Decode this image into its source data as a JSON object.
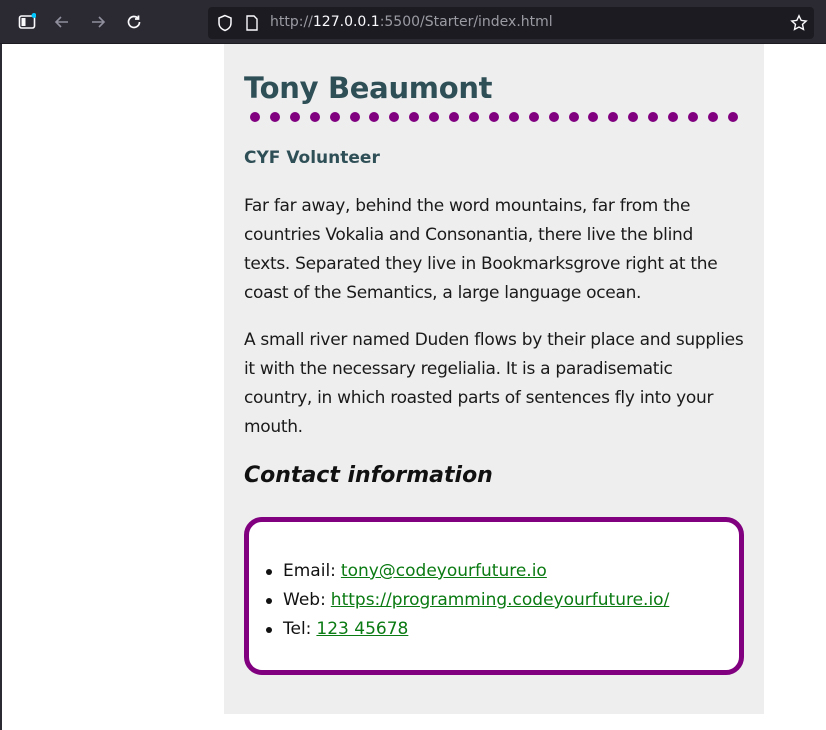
{
  "browser": {
    "url_prefix": "http://",
    "url_host": "127.0.0.1",
    "url_rest": ":5500/Starter/index.html"
  },
  "profile": {
    "name": "Tony Beaumont",
    "role": "CYF Volunteer",
    "paragraphs": [
      "Far far away, behind the word mountains, far from the countries Vokalia and Consonantia, there live the blind texts. Separated they live in Bookmarksgrove right at the coast of the Semantics, a large language ocean.",
      "A small river named Duden flows by their place and supplies it with the necessary regelialia. It is a paradisematic country, in which roasted parts of sentences fly into your mouth."
    ],
    "contact_title": "Contact information",
    "contacts": [
      {
        "label": "Email:",
        "value": "tony@codeyourfuture.io"
      },
      {
        "label": "Web:",
        "value": "https://programming.codeyourfuture.io/"
      },
      {
        "label": "Tel:",
        "value": "123 45678"
      }
    ]
  },
  "colors": {
    "accent": "#800080",
    "heading": "#2f4f57",
    "link": "#0a7a12",
    "card_bg": "#eeeeee"
  },
  "icons": [
    "sidebar-icon",
    "back-icon",
    "forward-icon",
    "reload-icon",
    "shield-icon",
    "page-icon",
    "star-icon"
  ]
}
